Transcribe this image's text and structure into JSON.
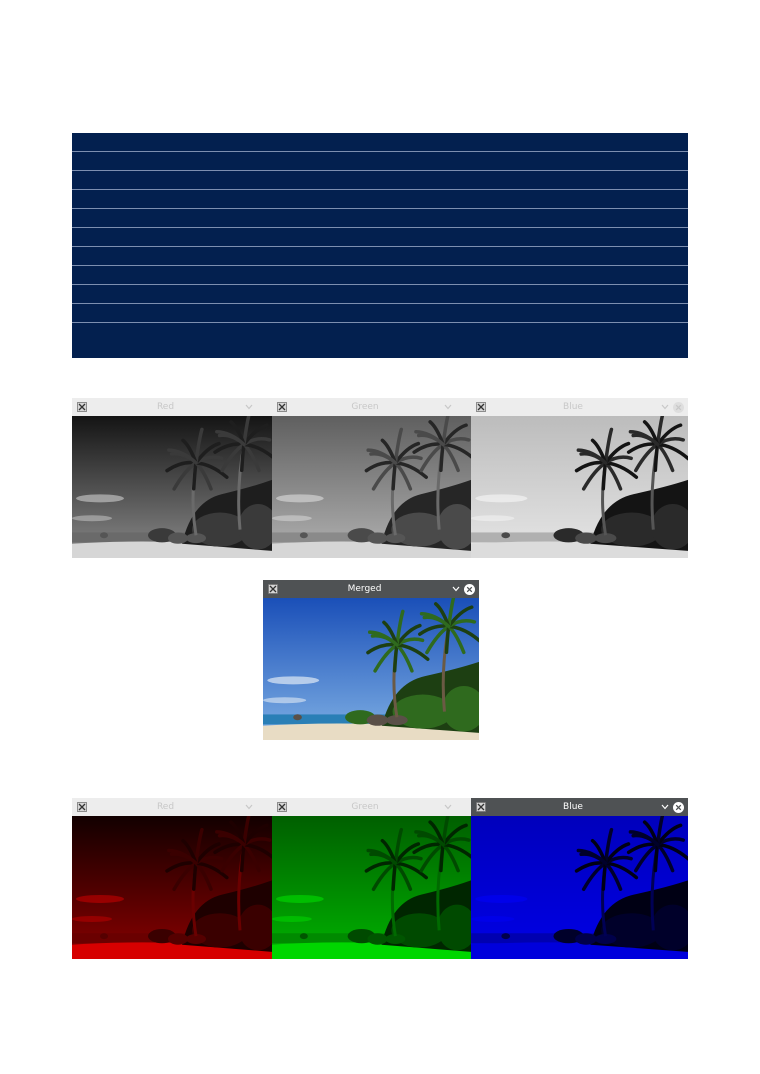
{
  "banner": {
    "line_count": 10
  },
  "row1": {
    "windows": [
      {
        "title": "Red",
        "variant": "gray-red",
        "active": false,
        "show_close": false
      },
      {
        "title": "Green",
        "variant": "gray-green",
        "active": false,
        "show_close": false
      },
      {
        "title": "Blue",
        "variant": "gray-blue",
        "active": false,
        "show_close": true
      }
    ]
  },
  "merged": {
    "title": "Merged",
    "variant": "color",
    "active": true,
    "show_close": true
  },
  "row3": {
    "windows": [
      {
        "title": "Red",
        "variant": "tint-red",
        "active": false,
        "show_close": false
      },
      {
        "title": "Green",
        "variant": "tint-green",
        "active": false,
        "show_close": false
      },
      {
        "title": "Blue",
        "variant": "tint-blue",
        "active": true,
        "show_close": true
      }
    ]
  },
  "colors": {
    "banner": "#03204f",
    "titlebar_active": "#4f5254",
    "titlebar_inactive": "#ededed"
  },
  "icons": {
    "app_icon": "x-window-icon",
    "minimize": "chevron-down-icon",
    "close": "close-circle-icon"
  }
}
